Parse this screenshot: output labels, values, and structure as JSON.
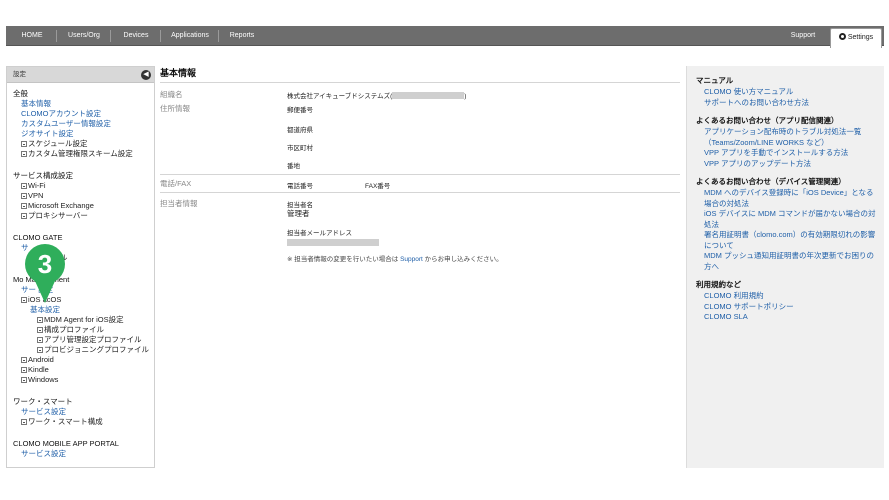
{
  "nav": {
    "items": [
      "HOME",
      "Users/Org",
      "Devices",
      "Applications",
      "Reports"
    ],
    "support": "Support",
    "settings": "Settings"
  },
  "sidebar": {
    "header": "設定",
    "collapse_glyph": "◀",
    "sections": [
      {
        "title": "全般",
        "items": [
          {
            "label": "基本情報",
            "link": true,
            "level": 1,
            "expand": false
          },
          {
            "label": "CLOMOアカウント設定",
            "link": true,
            "level": 1,
            "expand": false
          },
          {
            "label": "カスタムユーザー情報設定",
            "link": true,
            "level": 1,
            "expand": false
          },
          {
            "label": "ジオサイト設定",
            "link": true,
            "level": 1,
            "expand": false
          },
          {
            "label": "スケジュール設定",
            "link": false,
            "level": 1,
            "expand": true
          },
          {
            "label": "カスタム管理権限スキーム設定",
            "link": false,
            "level": 1,
            "expand": true
          }
        ]
      },
      {
        "title": "サービス構成設定",
        "items": [
          {
            "label": "Wi-Fi",
            "link": false,
            "level": 1,
            "expand": true
          },
          {
            "label": "VPN",
            "link": false,
            "level": 1,
            "expand": true
          },
          {
            "label": "Microsoft Exchange",
            "link": false,
            "level": 1,
            "expand": true
          },
          {
            "label": "プロキシサーバー",
            "link": false,
            "level": 1,
            "expand": true
          }
        ]
      },
      {
        "title": "CLOMO GATE",
        "items": [
          {
            "label": "サ",
            "link": true,
            "level": 1,
            "expand": false
          },
          {
            "label": "ントロール",
            "link": false,
            "level": 2,
            "expand": false
          }
        ]
      },
      {
        "title": "Mo      Management",
        "items": [
          {
            "label": "サー  設定",
            "link": true,
            "level": 1,
            "expand": false
          },
          {
            "label": "iOS   acOS",
            "link": false,
            "level": 1,
            "expand": true
          },
          {
            "label": "基本設定",
            "link": true,
            "level": 2,
            "expand": false
          },
          {
            "label": "MDM Agent for iOS設定",
            "link": false,
            "level": 3,
            "expand": true
          },
          {
            "label": "構成プロファイル",
            "link": false,
            "level": 3,
            "expand": true
          },
          {
            "label": "アプリ管理設定プロファイル",
            "link": false,
            "level": 3,
            "expand": true
          },
          {
            "label": "プロビジョニングプロファイル",
            "link": false,
            "level": 3,
            "expand": true
          },
          {
            "label": "Android",
            "link": false,
            "level": 1,
            "expand": true
          },
          {
            "label": "Kindle",
            "link": false,
            "level": 1,
            "expand": true
          },
          {
            "label": "Windows",
            "link": false,
            "level": 1,
            "expand": true
          }
        ]
      },
      {
        "title": "ワーク・スマート",
        "items": [
          {
            "label": "サービス設定",
            "link": true,
            "level": 1,
            "expand": false
          },
          {
            "label": "ワーク・スマート構成",
            "link": false,
            "level": 1,
            "expand": true
          }
        ]
      },
      {
        "title": "CLOMO MOBILE APP PORTAL",
        "items": [
          {
            "label": "サービス設定",
            "link": true,
            "level": 1,
            "expand": false
          }
        ]
      }
    ]
  },
  "step_marker": "3",
  "main": {
    "title": "基本情報",
    "org_label": "組織名",
    "org_value": "株式会社アイキューブドシステムズ(",
    "org_value_end": ")",
    "address_label": "住所情報",
    "postal": "郵便番号",
    "prefecture": "都道府県",
    "city": "市区町村",
    "street": "番地",
    "phone_label": "電話/FAX",
    "phone": "電話番号",
    "fax": "FAX番号",
    "contact_label": "担当者情報",
    "contact_name_label": "担当者名",
    "contact_name": "管理者",
    "contact_email_label": "担当者メールアドレス",
    "note_prefix": "※ 担当者情報の変更を行いたい場合は",
    "note_link": "Support",
    "note_suffix": "からお申し込みください。"
  },
  "right": {
    "sections": [
      {
        "title": "マニュアル",
        "links": [
          "CLOMO 使い方マニュアル",
          "サポートへのお問い合わせ方法"
        ]
      },
      {
        "title": "よくあるお問い合わせ（アプリ配信関連）",
        "links": [
          "アプリケーション配布時のトラブル対処法一覧（Teams/Zoom/LINE WORKS など）",
          "VPP アプリを手動でインストールする方法",
          "VPP アプリのアップデート方法"
        ]
      },
      {
        "title": "よくあるお問い合わせ（デバイス管理関連）",
        "links": [
          "MDM へのデバイス登録時に「iOS Device」となる場合の対処法",
          "iOS デバイスに MDM コマンドが届かない場合の対処法",
          "署名用証明書（clomo.com）の有効期限切れの影響について",
          "MDM プッシュ通知用証明書の年次更新でお困りの方へ"
        ]
      },
      {
        "title": "利用規約など",
        "links": [
          "CLOMO 利用規約",
          "CLOMO サポートポリシー",
          "CLOMO SLA"
        ]
      }
    ]
  }
}
